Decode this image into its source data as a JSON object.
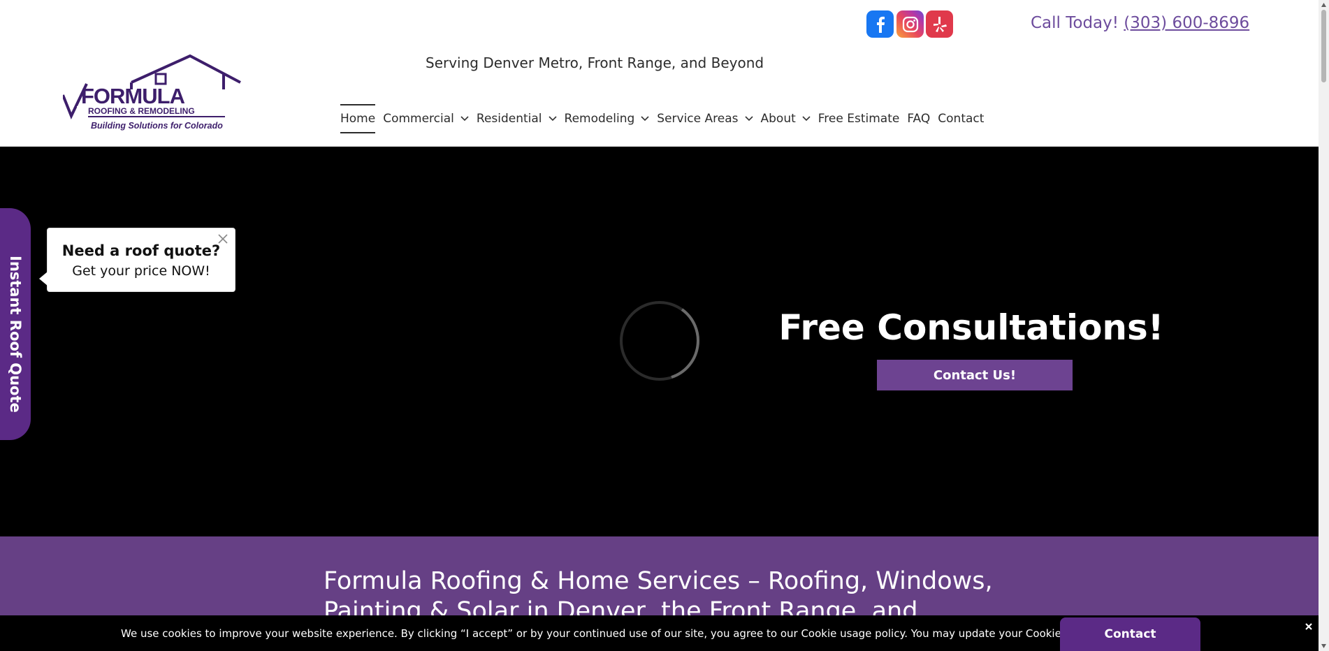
{
  "header": {
    "tagline": "Serving Denver Metro, Front Range, and Beyond",
    "call_label": "Call Today!",
    "phone": "(303) 600-8696",
    "social": [
      "facebook-icon",
      "instagram-icon",
      "yelp-icon"
    ],
    "logo": {
      "word": "FORMULA",
      "sub": "ROOFING & REMODELING",
      "slogan": "Building Solutions for Colorado"
    }
  },
  "nav": {
    "items": [
      {
        "label": "Home",
        "active": true,
        "dropdown": false
      },
      {
        "label": "Commercial",
        "dropdown": true
      },
      {
        "label": "Residential",
        "dropdown": true
      },
      {
        "label": "Remodeling",
        "dropdown": true
      },
      {
        "label": "Service Areas",
        "dropdown": true
      },
      {
        "label": "About",
        "dropdown": true
      },
      {
        "label": "Free Estimate",
        "dropdown": false
      },
      {
        "label": "FAQ",
        "dropdown": false
      },
      {
        "label": "Contact",
        "dropdown": false
      }
    ]
  },
  "hero": {
    "title": "Free Consultations!",
    "button": "Contact Us!"
  },
  "side_tab": {
    "label": "Instant Roof Quote"
  },
  "popup": {
    "title": "Need a roof quote?",
    "subtitle": "Get your price NOW!"
  },
  "band": {
    "heading": "Formula Roofing & Home Services – Roofing, Windows, Painting & Solar in Denver, the Front Range, and Beyond"
  },
  "cookie": {
    "text": "We use cookies to improve your website experience. By clicking “I accept” or by your continued use of our site, you agree to our Cookie usage policy. You may update your Cookie settings at anytime by adjusting your browser settings."
  },
  "contact_tab": {
    "label": "Contact"
  },
  "colors": {
    "brand_purple": "#664085",
    "accent_purple": "#6d4c9d",
    "facebook": "#1877f2",
    "yelp": "#e0394b"
  }
}
